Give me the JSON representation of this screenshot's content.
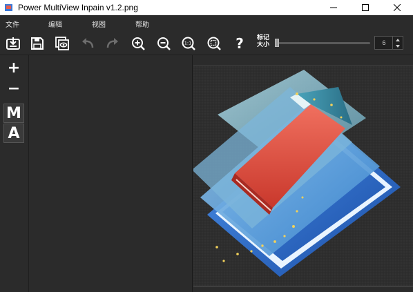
{
  "window": {
    "title": "Power MultiView Inpain v1.2.png",
    "minimize_icon": "minimize-icon",
    "maximize_icon": "maximize-icon",
    "close_icon": "close-icon"
  },
  "menu": {
    "items": [
      "文件",
      "编辑",
      "视图",
      "帮助"
    ]
  },
  "toolbar": {
    "buttons": [
      {
        "name": "open-file-button",
        "icon": "open-download-icon"
      },
      {
        "name": "save-button",
        "icon": "floppy-disk-icon"
      },
      {
        "name": "save-as-button",
        "icon": "layered-eye-icon"
      },
      {
        "name": "undo-button",
        "icon": "undo-icon",
        "disabled": true
      },
      {
        "name": "redo-button",
        "icon": "redo-icon",
        "disabled": true
      },
      {
        "name": "zoom-in-button",
        "icon": "zoom-in-icon"
      },
      {
        "name": "zoom-out-button",
        "icon": "zoom-out-icon"
      },
      {
        "name": "zoom-actual-button",
        "icon": "zoom-1to1-icon"
      },
      {
        "name": "zoom-fit-button",
        "icon": "zoom-fit-icon"
      },
      {
        "name": "help-button",
        "icon": "question-mark-icon"
      }
    ],
    "marker_label_line1": "标记",
    "marker_label_line2": "大小",
    "marker_size_value": "6",
    "marker_size_fraction": 0.0
  },
  "left_tools": {
    "add_label": "+",
    "remove_label": "−",
    "manual_label": "M",
    "auto_label": "A"
  },
  "colors": {
    "background": "#2b2b2b",
    "eraser_red": "#e2574c",
    "eraser_teal": "#3a8fa8",
    "frame_blue": "#2f6fd0",
    "sparkle": "#f2d15a"
  }
}
